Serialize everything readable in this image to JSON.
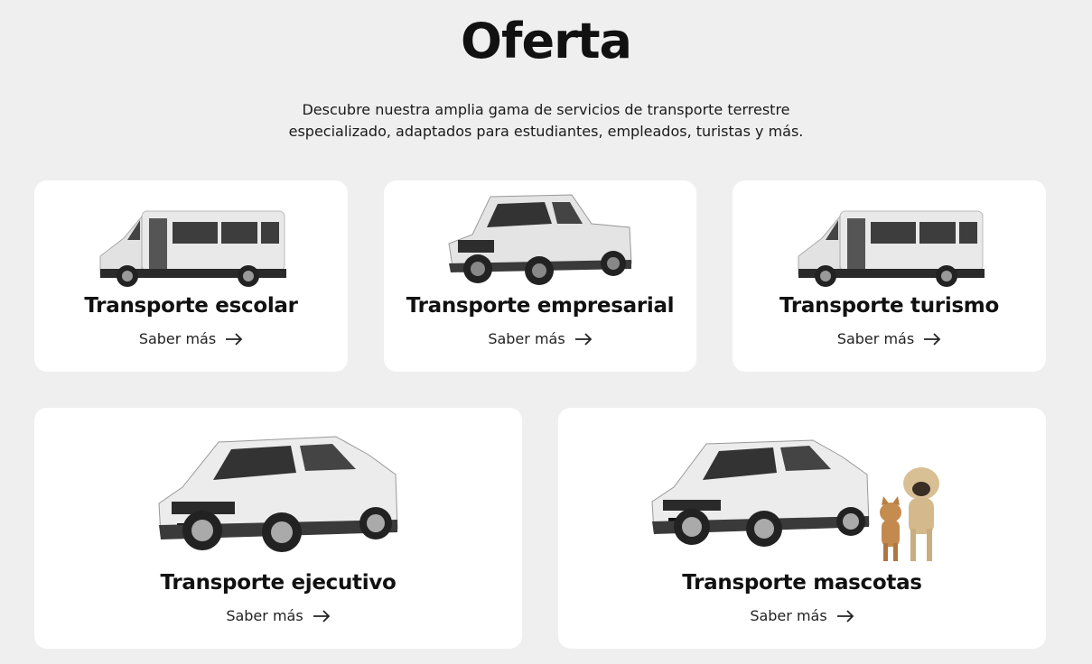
{
  "section": {
    "title": "Oferta",
    "description_lines": [
      "Descubre nuestra amplia gama de servicios de transporte terrestre",
      "especializado, adaptados para estudiantes, empleados, turistas y más."
    ]
  },
  "cards": [
    {
      "title": "Transporte escolar",
      "link": "Saber más",
      "vehicle": "white-van-icon"
    },
    {
      "title": "Transporte empresarial",
      "link": "Saber más",
      "vehicle": "pickup-truck-icon"
    },
    {
      "title": "Transporte turismo",
      "link": "Saber más",
      "vehicle": "white-van-icon"
    },
    {
      "title": "Transporte ejecutivo",
      "link": "Saber más",
      "vehicle": "suv-icon"
    },
    {
      "title": "Transporte mascotas",
      "link": "Saber más",
      "vehicle": "suv-with-pets-icon"
    }
  ],
  "colors": {
    "background": "#efefef",
    "card": "#ffffff",
    "text": "#111111"
  }
}
